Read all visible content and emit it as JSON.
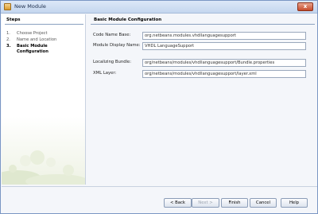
{
  "window": {
    "title": "New Module",
    "close_glyph": "x"
  },
  "steps": {
    "heading": "Steps",
    "items": [
      {
        "num": "1.",
        "label": "Choose Project"
      },
      {
        "num": "2.",
        "label": "Name and Location"
      },
      {
        "num": "3.",
        "label": "Basic Module",
        "label_line2": "Configuration"
      }
    ]
  },
  "panel": {
    "heading": "Basic Module Configuration",
    "fields": [
      {
        "label": "Code Name Base:",
        "value": "org.netbeans.modules.vhdllanguagesupport"
      },
      {
        "label": "Module Display Name:",
        "value": "VHDL LanguageSupport"
      },
      {
        "label": "Localizing Bundle:",
        "value": "org/netbeans/modules/vhdllanguagesupport/Bundle.properties"
      },
      {
        "label": "XML Layer:",
        "value": "org/netbeans/modules/vhdllanguagesupport/layer.xml"
      }
    ]
  },
  "buttons": {
    "back": "< Back",
    "next": "Next >",
    "finish": "Finish",
    "cancel": "Cancel",
    "help": "Help"
  },
  "colors": {
    "accent": "#7a96c4",
    "titlebar": "#c4d6ee",
    "close": "#c64a2a"
  },
  "icons": {
    "app": "netbeans-app-icon",
    "close": "close-icon"
  }
}
